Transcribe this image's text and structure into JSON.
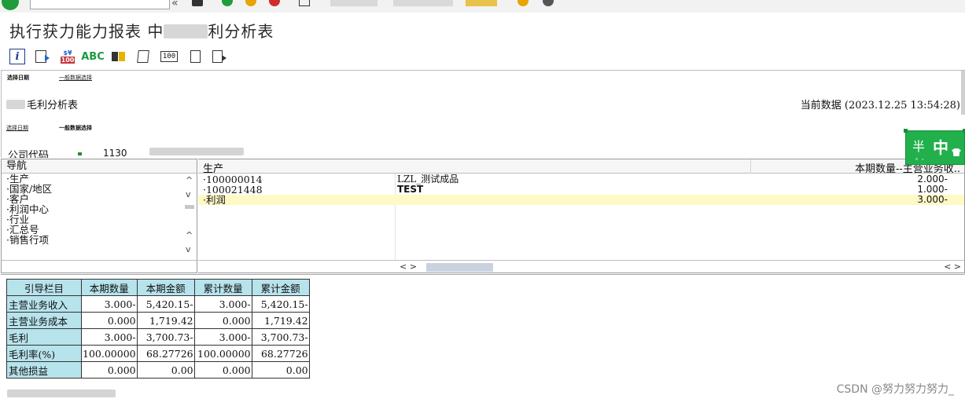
{
  "title": {
    "part1": "执行获力能力报表 中",
    "part2": "利分析表"
  },
  "header": {
    "link_select_date_top": "选择日期",
    "link_general_select_top": "一般数据选择",
    "report_title": "毛利分析表",
    "current_data": "当前数据 (2023.12.25 13:54:28)",
    "link_select_date": "选择日期",
    "link_general_select": "一般数据选择",
    "company_code_label": "公司代码",
    "company_code_value": "1130"
  },
  "navigation": {
    "header": "导航",
    "items": [
      "·生产",
      "·国家/地区",
      "·客户",
      "·利润中心",
      "·行业",
      "·汇总号",
      "·销售行项"
    ]
  },
  "grid": {
    "col_production": "生产",
    "col_quantity": "本期数量--主营业务收..",
    "rows": [
      {
        "id": "·100000014",
        "name": "LZL_测试成品",
        "qty": "2.000-"
      },
      {
        "id": "·100021448",
        "name": "TEST",
        "qty": "1.000-"
      },
      {
        "id": "·利润",
        "name": "",
        "qty": "3.000-"
      }
    ],
    "scroll_left_arrows": "<  >",
    "scroll_right_arrows": "<  >"
  },
  "summary": {
    "headers": [
      "引导栏目",
      "本期数量",
      "本期金额",
      "累计数量",
      "累计金额"
    ],
    "rows": [
      {
        "label": "主营业务收入",
        "cur_qty": "3.000-",
        "cur_amt": "5,420.15-",
        "acc_qty": "3.000-",
        "acc_amt": "5,420.15-"
      },
      {
        "label": "主营业务成本",
        "cur_qty": "0.000",
        "cur_amt": "1,719.42",
        "acc_qty": "0.000",
        "acc_amt": "1,719.42"
      },
      {
        "label": "毛利",
        "cur_qty": "3.000-",
        "cur_amt": "3,700.73-",
        "acc_qty": "3.000-",
        "acc_amt": "3,700.73-"
      },
      {
        "label": "毛利率(%)",
        "cur_qty": "100.00000",
        "cur_amt": "68.27726",
        "acc_qty": "100.00000",
        "acc_amt": "68.27726"
      },
      {
        "label": "其他损益",
        "cur_qty": "0.000",
        "cur_amt": "0.00",
        "acc_qty": "0.000",
        "acc_amt": "0.00"
      }
    ]
  },
  "ime": {
    "half_label": "半",
    "zh_label": "中"
  },
  "toolbar": {
    "currency_top": "$¥",
    "currency_bottom": "100",
    "abc_label": "ABC",
    "hundred_label": "100"
  },
  "watermark": "CSDN @努力努力努力_",
  "colors": {
    "ok_green": "#1f9d3a",
    "table_header_bg": "#b7e3ec",
    "highlight_row": "#fff9c6",
    "ime_green": "#21b04b"
  }
}
